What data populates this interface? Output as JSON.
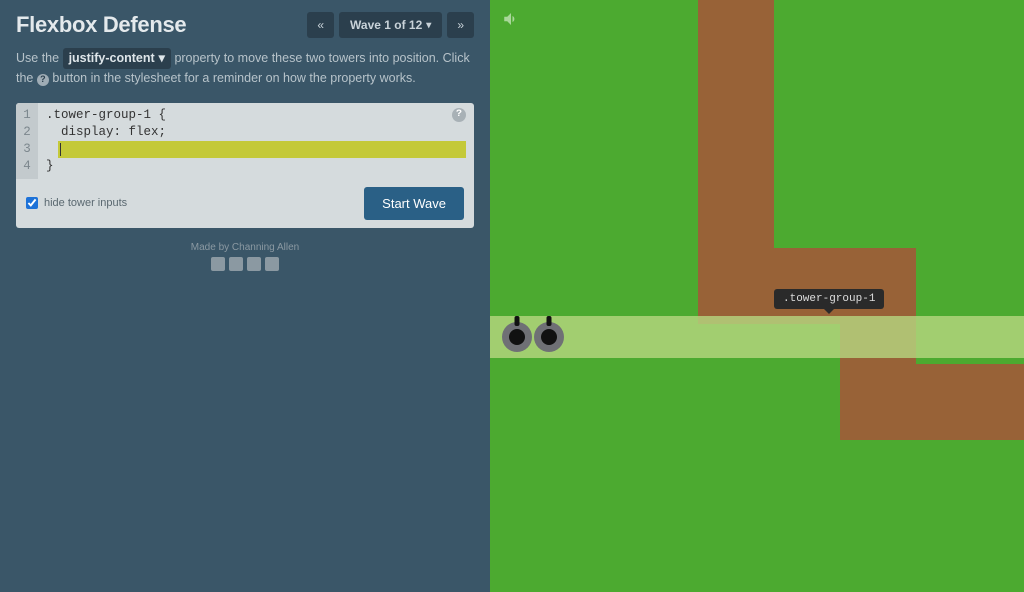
{
  "header": {
    "title": "Flexbox Defense",
    "prev_label": "«",
    "wave_label": "Wave 1 of 12",
    "next_label": "»"
  },
  "instructions": {
    "pre": "Use the ",
    "prop": "justify-content",
    "mid": " property to move these two towers into position. Click the ",
    "post": " button in the stylesheet for a reminder on how the property works."
  },
  "editor": {
    "line1": ".tower-group-1 {",
    "line2": "  display: flex;",
    "line4": "}",
    "input_value": "",
    "help_glyph": "?"
  },
  "footer": {
    "checkbox_label": "hide tower inputs",
    "checkbox_checked": true,
    "start_label": "Start Wave"
  },
  "credits": {
    "text": "Made by Channing Allen"
  },
  "game": {
    "tooltip": ".tower-group-1"
  }
}
